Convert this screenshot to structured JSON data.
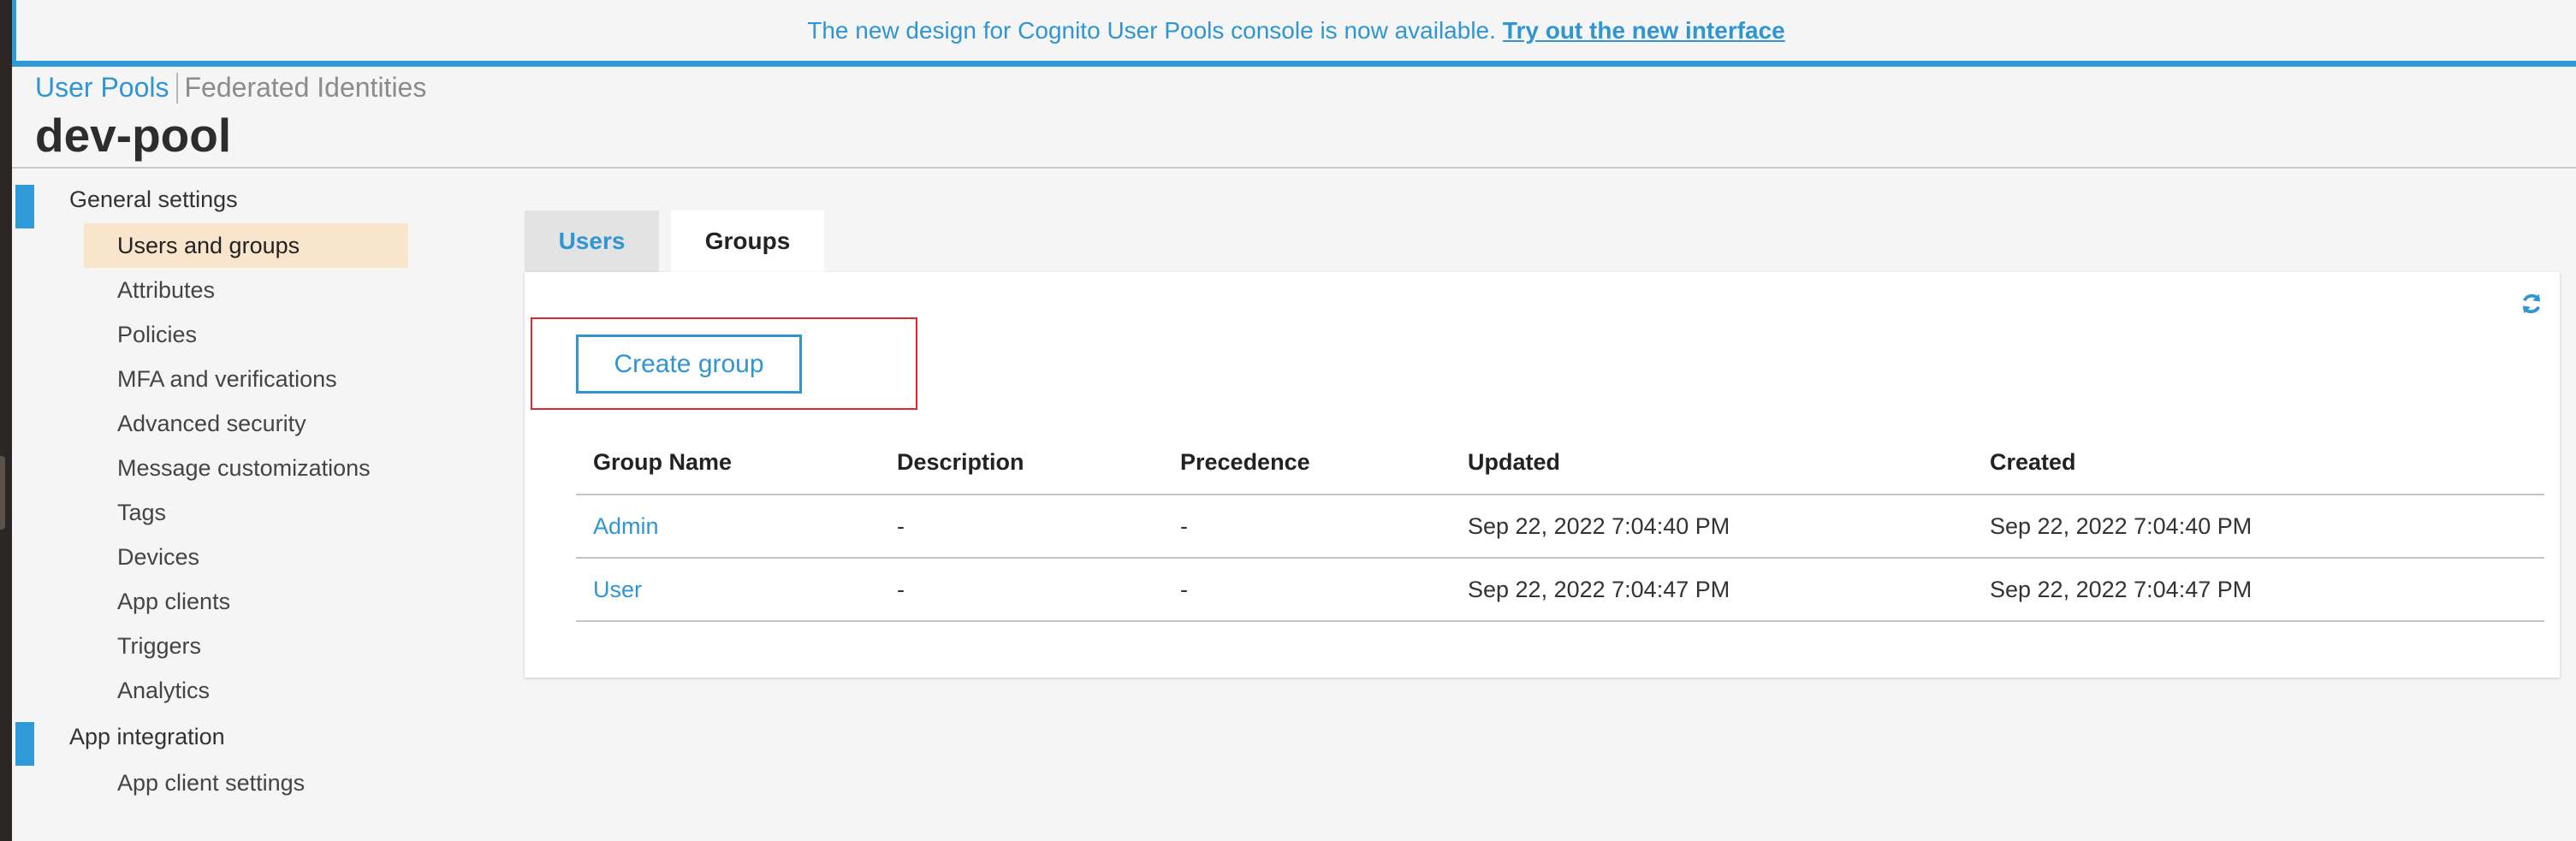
{
  "banner": {
    "text": "The new design for Cognito User Pools console is now available.",
    "link": "Try out the new interface"
  },
  "breadcrumb": {
    "user_pools": "User Pools",
    "federated_identities": "Federated Identities"
  },
  "pool_title": "dev-pool",
  "sidebar": {
    "general_settings": "General settings",
    "items": [
      {
        "label": "Users and groups",
        "active": true
      },
      {
        "label": "Attributes"
      },
      {
        "label": "Policies"
      },
      {
        "label": "MFA and verifications"
      },
      {
        "label": "Advanced security"
      },
      {
        "label": "Message customizations"
      },
      {
        "label": "Tags"
      },
      {
        "label": "Devices"
      },
      {
        "label": "App clients"
      },
      {
        "label": "Triggers"
      },
      {
        "label": "Analytics"
      }
    ],
    "app_integration": "App integration",
    "app_items": [
      {
        "label": "App client settings"
      }
    ]
  },
  "tabs": {
    "users": "Users",
    "groups": "Groups",
    "active": "Groups"
  },
  "panel": {
    "create_group": "Create group",
    "refresh_icon": "refresh-icon",
    "columns": [
      "Group Name",
      "Description",
      "Precedence",
      "Updated",
      "Created"
    ],
    "rows": [
      [
        "Admin",
        "-",
        "-",
        "Sep 22, 2022 7:04:40 PM",
        "Sep 22, 2022 7:04:40 PM"
      ],
      [
        "User",
        "-",
        "-",
        "Sep 22, 2022 7:04:47 PM",
        "Sep 22, 2022 7:04:47 PM"
      ]
    ]
  },
  "colors": {
    "accent": "#2f95d3",
    "active_nav": "#f9e4cc",
    "highlight": "#e1262b"
  }
}
